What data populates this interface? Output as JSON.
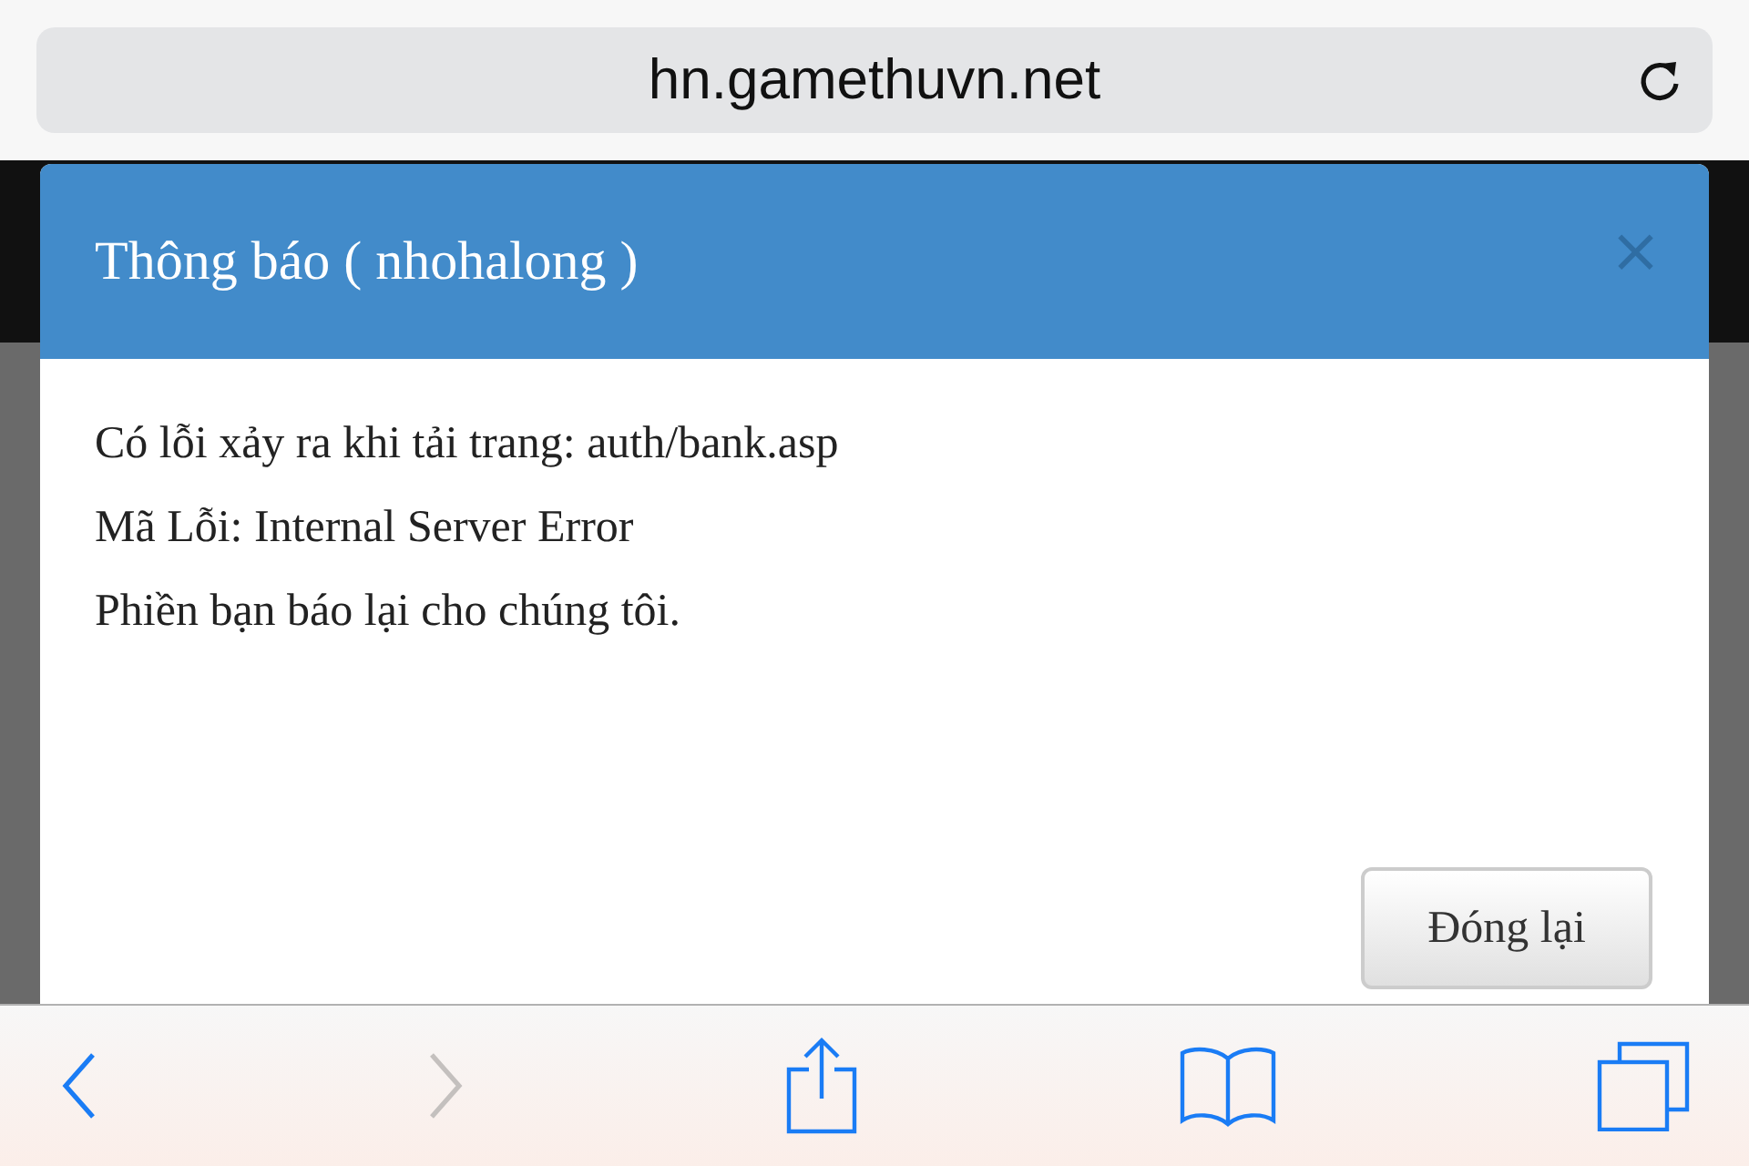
{
  "address_bar": {
    "url": "hn.gamethuvn.net"
  },
  "dialog": {
    "title": "Thông báo ( nhohalong )",
    "close": "×",
    "lines": [
      "Có lỗi xảy ra khi tải trang: auth/bank.asp",
      "Mã Lỗi: Internal Server Error",
      "Phiền bạn báo lại cho chúng tôi."
    ],
    "button": "Đóng lại"
  },
  "toolbar": {
    "back": {
      "disabled": false
    },
    "forward": {
      "disabled": true
    }
  }
}
